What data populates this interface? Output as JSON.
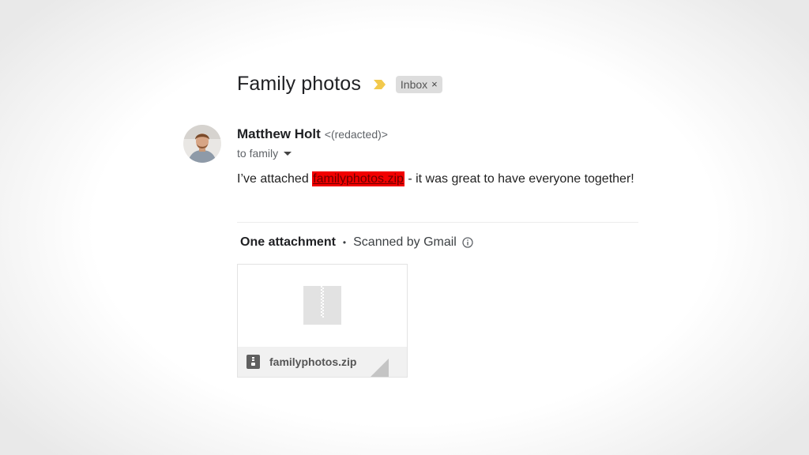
{
  "email": {
    "subject": "Family photos",
    "label": {
      "name": "Inbox",
      "remove": "×"
    },
    "importance_marker": "important-marker-icon",
    "sender": {
      "name": "Matthew Holt",
      "email": "<(redacted)>"
    },
    "recipients": "to family",
    "body": {
      "prefix": "I’ve attached ",
      "link_text": "familyphotos.zip",
      "suffix": " - it was great to have everyone together!"
    }
  },
  "attachments": {
    "count_label": "One attachment",
    "separator": "•",
    "scan_label": "Scanned by Gmail",
    "files": [
      {
        "name": "familyphotos.zip",
        "type": "zip"
      }
    ]
  },
  "colors": {
    "importance": "#f2c94c",
    "link_highlight": "#f20000",
    "label_chip": "#dddddd"
  }
}
